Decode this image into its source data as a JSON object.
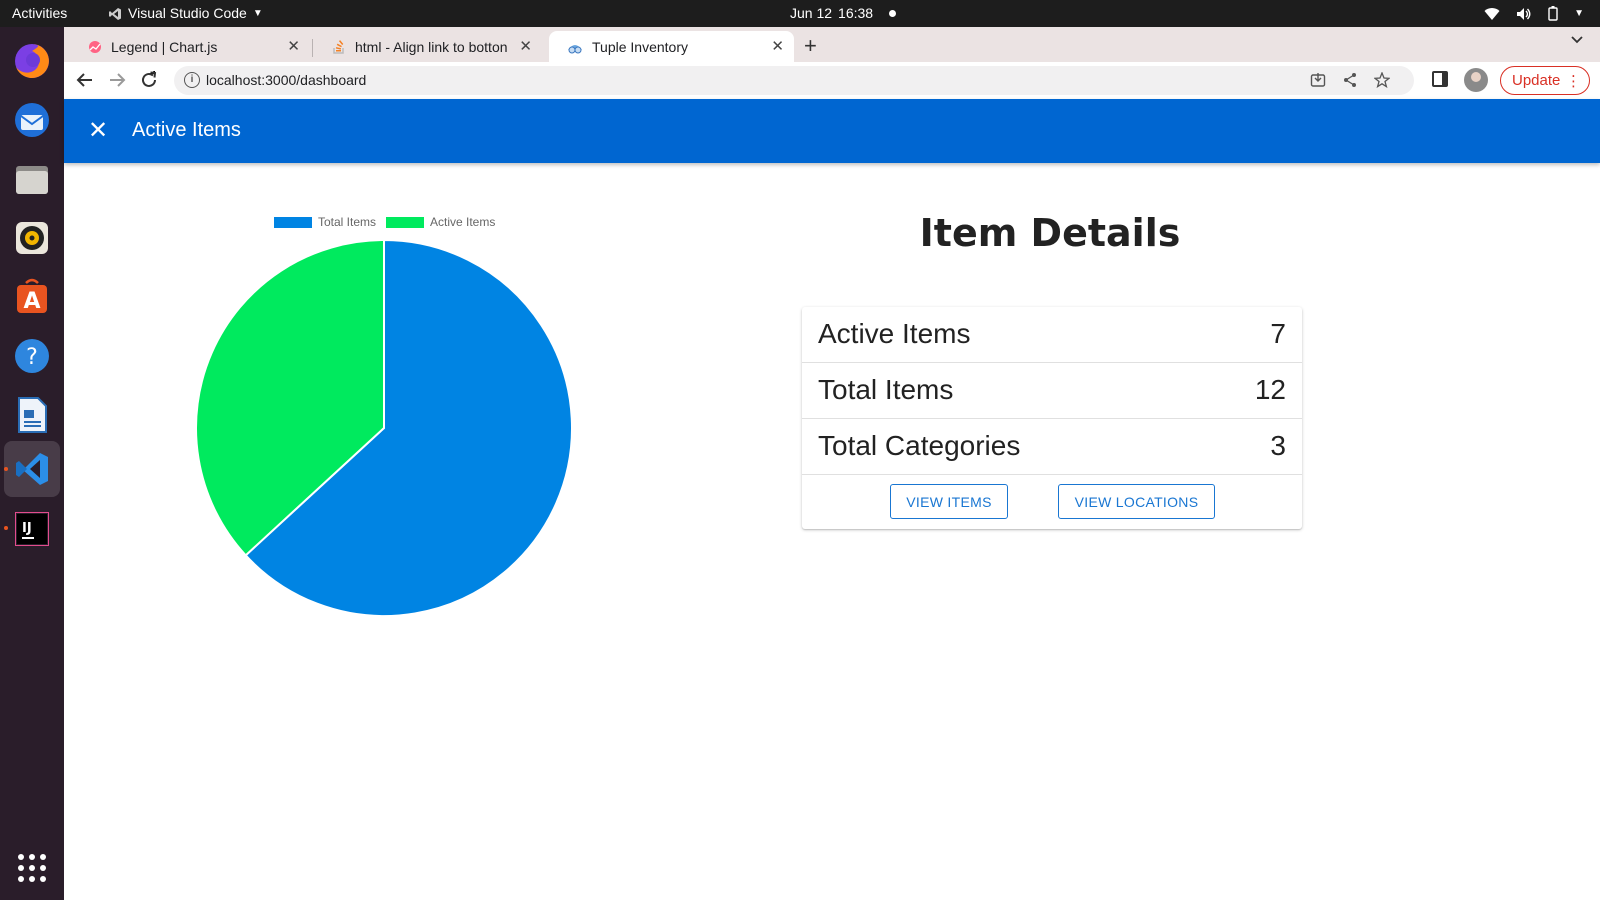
{
  "system_bar": {
    "activities": "Activities",
    "app_name": "Visual Studio Code",
    "date": "Jun 12",
    "time": "16:38"
  },
  "dock": {
    "items": [
      "Firefox",
      "Thunderbird",
      "Files",
      "Rhythmbox",
      "Ubuntu Software",
      "Help",
      "LibreOffice Writer",
      "Visual Studio Code",
      "IntelliJ IDEA"
    ]
  },
  "browser": {
    "tabs": [
      {
        "title": "Legend | Chart.js",
        "icon": "chartjs-icon"
      },
      {
        "title": "html - Align link to botton",
        "icon": "stackoverflow-icon"
      },
      {
        "title": "Tuple Inventory",
        "icon": "app-icon"
      }
    ],
    "url": "localhost:3000/dashboard",
    "update_label": "Update"
  },
  "app": {
    "title": "Active Items"
  },
  "details": {
    "title": "Item Details",
    "rows": [
      {
        "label": "Active Items",
        "value": "7"
      },
      {
        "label": "Total Items",
        "value": "12"
      },
      {
        "label": "Total Categories",
        "value": "3"
      }
    ],
    "buttons": {
      "view_items": "VIEW ITEMS",
      "view_locations": "VIEW LOCATIONS"
    }
  },
  "chart_data": {
    "type": "pie",
    "categories": [
      "Total Items",
      "Active Items"
    ],
    "values": [
      12,
      7
    ],
    "colors": [
      "#0084e3",
      "#00ea5e"
    ],
    "legend": "top"
  }
}
